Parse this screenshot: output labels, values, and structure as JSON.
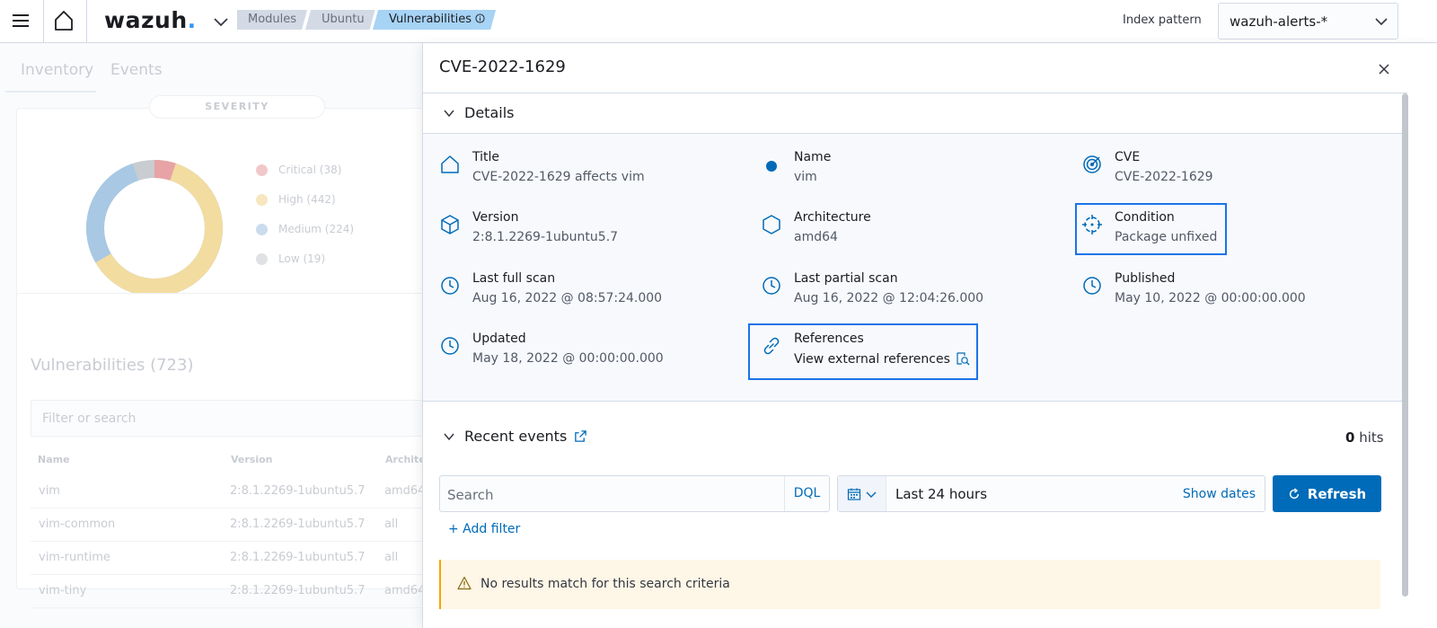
{
  "header": {
    "logo": "wazuh",
    "logo_dot": ".",
    "breadcrumbs": [
      "Modules",
      "Ubuntu",
      "Vulnerabilities"
    ],
    "index_pattern_label": "Index pattern",
    "index_pattern_value": "wazuh-alerts-*"
  },
  "background": {
    "tabs": [
      "Inventory",
      "Events"
    ],
    "severity_title": "SEVERITY",
    "legend": [
      {
        "label": "Critical (38)",
        "color": "#e7a3a6"
      },
      {
        "label": "High (442)",
        "color": "#f2dca0"
      },
      {
        "label": "Medium (224)",
        "color": "#a8c8e4"
      },
      {
        "label": "Low (19)",
        "color": "#c9ccd1"
      }
    ],
    "vulnerabilities_title": "Vulnerabilities (723)",
    "search_placeholder": "Filter or search",
    "columns": [
      "Name",
      "Version",
      "Architecture"
    ],
    "rows": [
      [
        "vim",
        "2:8.1.2269-1ubuntu5.7",
        "amd64"
      ],
      [
        "vim-common",
        "2:8.1.2269-1ubuntu5.7",
        "all"
      ],
      [
        "vim-runtime",
        "2:8.1.2269-1ubuntu5.7",
        "all"
      ],
      [
        "vim-tiny",
        "2:8.1.2269-1ubuntu5.7",
        "amd64"
      ]
    ]
  },
  "flyout": {
    "title": "CVE-2022-1629",
    "details_label": "Details",
    "fields": {
      "title": {
        "label": "Title",
        "value": "CVE-2022-1629 affects vim"
      },
      "name": {
        "label": "Name",
        "value": "vim"
      },
      "cve": {
        "label": "CVE",
        "value": "CVE-2022-1629"
      },
      "version": {
        "label": "Version",
        "value": "2:8.1.2269-1ubuntu5.7"
      },
      "architecture": {
        "label": "Architecture",
        "value": "amd64"
      },
      "condition": {
        "label": "Condition",
        "value": "Package unfixed"
      },
      "last_full_scan": {
        "label": "Last full scan",
        "value": "Aug 16, 2022 @ 08:57:24.000"
      },
      "last_partial_scan": {
        "label": "Last partial scan",
        "value": "Aug 16, 2022 @ 12:04:26.000"
      },
      "published": {
        "label": "Published",
        "value": "May 10, 2022 @ 00:00:00.000"
      },
      "updated": {
        "label": "Updated",
        "value": "May 18, 2022 @ 00:00:00.000"
      },
      "references": {
        "label": "References",
        "value": "View external references"
      }
    },
    "recent_events_label": "Recent events",
    "hits_count": "0",
    "hits_label": "hits",
    "search_placeholder": "Search",
    "dql_label": "DQL",
    "time_range": "Last 24 hours",
    "show_dates_label": "Show dates",
    "refresh_label": "Refresh",
    "add_filter_label": "+ Add filter",
    "callout_message": "No results match for this search criteria"
  },
  "colors": {
    "primary": "#006bb8",
    "highlight": "#1a73e8",
    "warning": "#f5a700"
  }
}
